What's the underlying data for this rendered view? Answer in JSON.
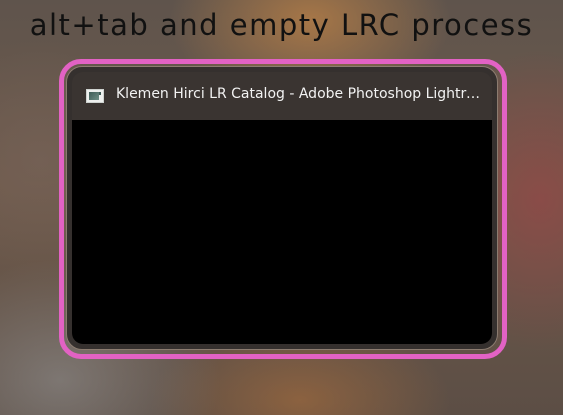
{
  "caption": "alt+tab and empty LRC process",
  "task_switcher": {
    "window": {
      "title": "Klemen Hirci LR Catalog - Adobe Photoshop Lightroom Classic",
      "icon": "lightroom-app-icon",
      "preview": "empty"
    }
  },
  "colors": {
    "highlight_ring": "#e262c4",
    "card_background": "#35302e",
    "preview_background": "#000000",
    "caption_text": "#111111",
    "title_text": "#f2f2f2"
  }
}
